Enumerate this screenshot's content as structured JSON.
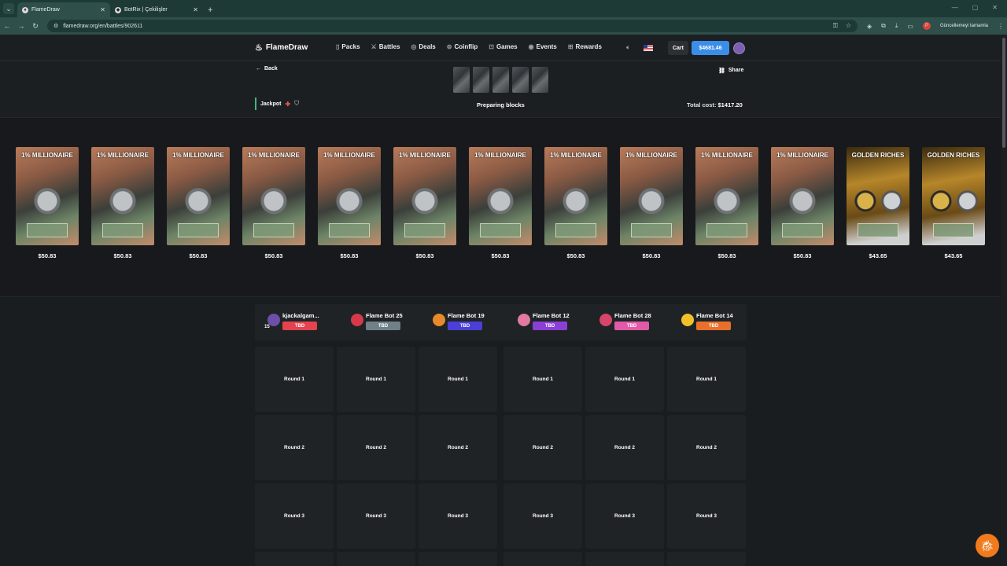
{
  "browser": {
    "tabs": [
      {
        "title": "FlameDraw",
        "active": true
      },
      {
        "title": "BotRix | Çekilişler",
        "active": false
      }
    ],
    "url": "flamedraw.org/en/battles/902611",
    "update_text": "Güncellemeyi tamamla",
    "profile_initial": "P"
  },
  "header": {
    "brand": "FlameDraw",
    "nav": [
      {
        "label": "Packs",
        "icon": "pack-icon"
      },
      {
        "label": "Battles",
        "icon": "swords-icon"
      },
      {
        "label": "Deals",
        "icon": "deals-icon"
      },
      {
        "label": "Coinflip",
        "icon": "coin-icon"
      },
      {
        "label": "Games",
        "icon": "gamepad-icon"
      },
      {
        "label": "Events",
        "icon": "events-icon"
      },
      {
        "label": "Rewards",
        "icon": "gift-icon"
      }
    ],
    "cart_label": "Cart",
    "balance": "$4681.46"
  },
  "battle": {
    "back_label": "Back",
    "share_label": "Share",
    "mode_label": "Jackpot",
    "status": "Preparing blocks",
    "total_cost_label": "Total cost:",
    "total_cost": "$1417.20",
    "pack_count": 5
  },
  "reel": [
    {
      "name": "1% MILLIONAIRE",
      "price": "$50.83",
      "theme": "millionaire"
    },
    {
      "name": "1% MILLIONAIRE",
      "price": "$50.83",
      "theme": "millionaire"
    },
    {
      "name": "1% MILLIONAIRE",
      "price": "$50.83",
      "theme": "millionaire"
    },
    {
      "name": "1% MILLIONAIRE",
      "price": "$50.83",
      "theme": "millionaire"
    },
    {
      "name": "1% MILLIONAIRE",
      "price": "$50.83",
      "theme": "millionaire"
    },
    {
      "name": "1% MILLIONAIRE",
      "price": "$50.83",
      "theme": "millionaire"
    },
    {
      "name": "1% MILLIONAIRE",
      "price": "$50.83",
      "theme": "millionaire"
    },
    {
      "name": "1% MILLIONAIRE",
      "price": "$50.83",
      "theme": "millionaire"
    },
    {
      "name": "1% MILLIONAIRE",
      "price": "$50.83",
      "theme": "millionaire"
    },
    {
      "name": "1% MILLIONAIRE",
      "price": "$50.83",
      "theme": "millionaire"
    },
    {
      "name": "1% MILLIONAIRE",
      "price": "$50.83",
      "theme": "millionaire"
    },
    {
      "name": "GOLDEN RICHES",
      "price": "$43.65",
      "theme": "golden"
    },
    {
      "name": "GOLDEN RICHES",
      "price": "$43.65",
      "theme": "golden"
    }
  ],
  "players": [
    {
      "name": "kjackalgam...",
      "status": "TBD",
      "badge_color": "#e2434f",
      "avatar_color": "#6b4fa8",
      "level": "15"
    },
    {
      "name": "Flame Bot 25",
      "status": "TBD",
      "badge_color": "#6f8088",
      "avatar_color": "#d63a4a"
    },
    {
      "name": "Flame Bot 19",
      "status": "TBD",
      "badge_color": "#4a3fd6",
      "avatar_color": "#e88a2a"
    },
    {
      "name": "Flame Bot 12",
      "status": "TBD",
      "badge_color": "#8a3fd6",
      "avatar_color": "#e07aa0"
    },
    {
      "name": "Flame Bot 28",
      "status": "TBD",
      "badge_color": "#e05aa8",
      "avatar_color": "#d8456a"
    },
    {
      "name": "Flame Bot 14",
      "status": "TBD",
      "badge_color": "#e8702a",
      "avatar_color": "#f2c12a"
    }
  ],
  "rounds": [
    "Round 1",
    "Round 2",
    "Round 3"
  ]
}
